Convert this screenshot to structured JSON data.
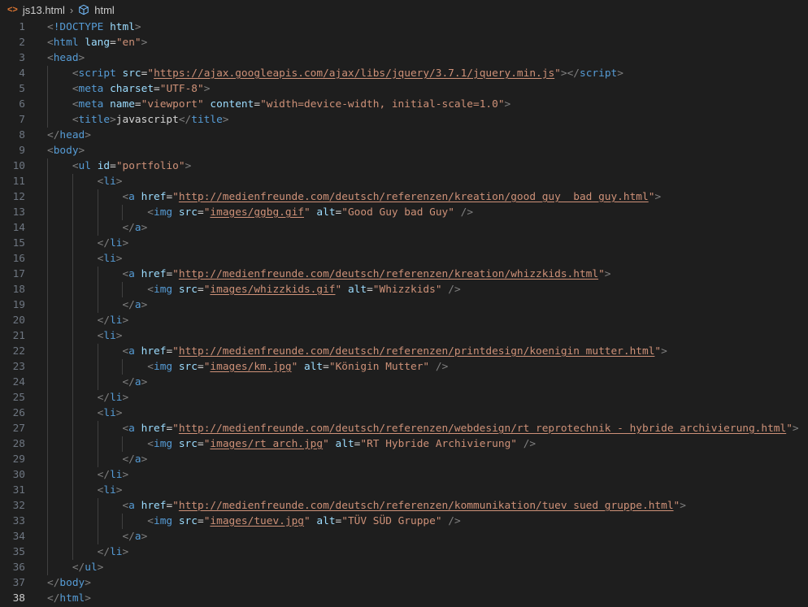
{
  "breadcrumb": {
    "file_icon": "<>",
    "file": "js13.html",
    "symbol_icon": "cube-icon",
    "symbol": "html"
  },
  "editor": {
    "active_line": 38,
    "lines": [
      {
        "n": "1",
        "indent": 0,
        "tokens": [
          [
            "punc",
            "<"
          ],
          [
            "tag",
            "!DOCTYPE"
          ],
          [
            "text",
            " "
          ],
          [
            "attr",
            "html"
          ],
          [
            "punc",
            ">"
          ]
        ]
      },
      {
        "n": "2",
        "indent": 0,
        "tokens": [
          [
            "punc",
            "<"
          ],
          [
            "tag",
            "html"
          ],
          [
            "text",
            " "
          ],
          [
            "attr",
            "lang"
          ],
          [
            "text",
            "="
          ],
          [
            "str",
            "\"en\""
          ],
          [
            "punc",
            ">"
          ]
        ]
      },
      {
        "n": "3",
        "indent": 0,
        "tokens": [
          [
            "punc",
            "<"
          ],
          [
            "tag",
            "head"
          ],
          [
            "punc",
            ">"
          ]
        ]
      },
      {
        "n": "4",
        "indent": 1,
        "tokens": [
          [
            "punc",
            "<"
          ],
          [
            "tag",
            "script"
          ],
          [
            "text",
            " "
          ],
          [
            "attr",
            "src"
          ],
          [
            "text",
            "="
          ],
          [
            "str",
            "\""
          ],
          [
            "link",
            "https://ajax.googleapis.com/ajax/libs/jquery/3.7.1/jquery.min.js"
          ],
          [
            "str",
            "\""
          ],
          [
            "punc",
            "></"
          ],
          [
            "tag",
            "script"
          ],
          [
            "punc",
            ">"
          ]
        ]
      },
      {
        "n": "5",
        "indent": 1,
        "tokens": [
          [
            "punc",
            "<"
          ],
          [
            "tag",
            "meta"
          ],
          [
            "text",
            " "
          ],
          [
            "attr",
            "charset"
          ],
          [
            "text",
            "="
          ],
          [
            "str",
            "\"UTF-8\""
          ],
          [
            "punc",
            ">"
          ]
        ]
      },
      {
        "n": "6",
        "indent": 1,
        "tokens": [
          [
            "punc",
            "<"
          ],
          [
            "tag",
            "meta"
          ],
          [
            "text",
            " "
          ],
          [
            "attr",
            "name"
          ],
          [
            "text",
            "="
          ],
          [
            "str",
            "\"viewport\""
          ],
          [
            "text",
            " "
          ],
          [
            "attr",
            "content"
          ],
          [
            "text",
            "="
          ],
          [
            "str",
            "\"width=device-width, initial-scale=1.0\""
          ],
          [
            "punc",
            ">"
          ]
        ]
      },
      {
        "n": "7",
        "indent": 1,
        "tokens": [
          [
            "punc",
            "<"
          ],
          [
            "tag",
            "title"
          ],
          [
            "punc",
            ">"
          ],
          [
            "text",
            "javascript"
          ],
          [
            "punc",
            "</"
          ],
          [
            "tag",
            "title"
          ],
          [
            "punc",
            ">"
          ]
        ]
      },
      {
        "n": "8",
        "indent": 0,
        "tokens": [
          [
            "punc",
            "</"
          ],
          [
            "tag",
            "head"
          ],
          [
            "punc",
            ">"
          ]
        ]
      },
      {
        "n": "9",
        "indent": 0,
        "tokens": [
          [
            "punc",
            "<"
          ],
          [
            "tag",
            "body"
          ],
          [
            "punc",
            ">"
          ]
        ]
      },
      {
        "n": "10",
        "indent": 1,
        "tokens": [
          [
            "punc",
            "<"
          ],
          [
            "tag",
            "ul"
          ],
          [
            "text",
            " "
          ],
          [
            "attr",
            "id"
          ],
          [
            "text",
            "="
          ],
          [
            "str",
            "\"portfolio\""
          ],
          [
            "punc",
            ">"
          ]
        ]
      },
      {
        "n": "11",
        "indent": 2,
        "tokens": [
          [
            "punc",
            "<"
          ],
          [
            "tag",
            "li"
          ],
          [
            "punc",
            ">"
          ]
        ]
      },
      {
        "n": "12",
        "indent": 3,
        "tokens": [
          [
            "punc",
            "<"
          ],
          [
            "tag",
            "a"
          ],
          [
            "text",
            " "
          ],
          [
            "attr",
            "href"
          ],
          [
            "text",
            "="
          ],
          [
            "str",
            "\""
          ],
          [
            "link",
            "http://medienfreunde.com/deutsch/referenzen/kreation/good_guy__bad_guy.html"
          ],
          [
            "str",
            "\""
          ],
          [
            "punc",
            ">"
          ]
        ]
      },
      {
        "n": "13",
        "indent": 4,
        "tokens": [
          [
            "punc",
            "<"
          ],
          [
            "tag",
            "img"
          ],
          [
            "text",
            " "
          ],
          [
            "attr",
            "src"
          ],
          [
            "text",
            "="
          ],
          [
            "str",
            "\""
          ],
          [
            "link",
            "images/ggbg.gif"
          ],
          [
            "str",
            "\""
          ],
          [
            "text",
            " "
          ],
          [
            "attr",
            "alt"
          ],
          [
            "text",
            "="
          ],
          [
            "str",
            "\"Good Guy bad Guy\""
          ],
          [
            "text",
            " "
          ],
          [
            "punc",
            "/>"
          ]
        ]
      },
      {
        "n": "14",
        "indent": 3,
        "tokens": [
          [
            "punc",
            "</"
          ],
          [
            "tag",
            "a"
          ],
          [
            "punc",
            ">"
          ]
        ]
      },
      {
        "n": "15",
        "indent": 2,
        "tokens": [
          [
            "punc",
            "</"
          ],
          [
            "tag",
            "li"
          ],
          [
            "punc",
            ">"
          ]
        ]
      },
      {
        "n": "16",
        "indent": 2,
        "tokens": [
          [
            "punc",
            "<"
          ],
          [
            "tag",
            "li"
          ],
          [
            "punc",
            ">"
          ]
        ]
      },
      {
        "n": "17",
        "indent": 3,
        "tokens": [
          [
            "punc",
            "<"
          ],
          [
            "tag",
            "a"
          ],
          [
            "text",
            " "
          ],
          [
            "attr",
            "href"
          ],
          [
            "text",
            "="
          ],
          [
            "str",
            "\""
          ],
          [
            "link",
            "http://medienfreunde.com/deutsch/referenzen/kreation/whizzkids.html"
          ],
          [
            "str",
            "\""
          ],
          [
            "punc",
            ">"
          ]
        ]
      },
      {
        "n": "18",
        "indent": 4,
        "tokens": [
          [
            "punc",
            "<"
          ],
          [
            "tag",
            "img"
          ],
          [
            "text",
            " "
          ],
          [
            "attr",
            "src"
          ],
          [
            "text",
            "="
          ],
          [
            "str",
            "\""
          ],
          [
            "link",
            "images/whizzkids.gif"
          ],
          [
            "str",
            "\""
          ],
          [
            "text",
            " "
          ],
          [
            "attr",
            "alt"
          ],
          [
            "text",
            "="
          ],
          [
            "str",
            "\"Whizzkids\""
          ],
          [
            "text",
            " "
          ],
          [
            "punc",
            "/>"
          ]
        ]
      },
      {
        "n": "19",
        "indent": 3,
        "tokens": [
          [
            "punc",
            "</"
          ],
          [
            "tag",
            "a"
          ],
          [
            "punc",
            ">"
          ]
        ]
      },
      {
        "n": "20",
        "indent": 2,
        "tokens": [
          [
            "punc",
            "</"
          ],
          [
            "tag",
            "li"
          ],
          [
            "punc",
            ">"
          ]
        ]
      },
      {
        "n": "21",
        "indent": 2,
        "tokens": [
          [
            "punc",
            "<"
          ],
          [
            "tag",
            "li"
          ],
          [
            "punc",
            ">"
          ]
        ]
      },
      {
        "n": "22",
        "indent": 3,
        "tokens": [
          [
            "punc",
            "<"
          ],
          [
            "tag",
            "a"
          ],
          [
            "text",
            " "
          ],
          [
            "attr",
            "href"
          ],
          [
            "text",
            "="
          ],
          [
            "str",
            "\""
          ],
          [
            "link",
            "http://medienfreunde.com/deutsch/referenzen/printdesign/koenigin_mutter.html"
          ],
          [
            "str",
            "\""
          ],
          [
            "punc",
            ">"
          ]
        ]
      },
      {
        "n": "23",
        "indent": 4,
        "tokens": [
          [
            "punc",
            "<"
          ],
          [
            "tag",
            "img"
          ],
          [
            "text",
            " "
          ],
          [
            "attr",
            "src"
          ],
          [
            "text",
            "="
          ],
          [
            "str",
            "\""
          ],
          [
            "link",
            "images/km.jpg"
          ],
          [
            "str",
            "\""
          ],
          [
            "text",
            " "
          ],
          [
            "attr",
            "alt"
          ],
          [
            "text",
            "="
          ],
          [
            "str",
            "\"Königin Mutter\""
          ],
          [
            "text",
            " "
          ],
          [
            "punc",
            "/>"
          ]
        ]
      },
      {
        "n": "24",
        "indent": 3,
        "tokens": [
          [
            "punc",
            "</"
          ],
          [
            "tag",
            "a"
          ],
          [
            "punc",
            ">"
          ]
        ]
      },
      {
        "n": "25",
        "indent": 2,
        "tokens": [
          [
            "punc",
            "</"
          ],
          [
            "tag",
            "li"
          ],
          [
            "punc",
            ">"
          ]
        ]
      },
      {
        "n": "26",
        "indent": 2,
        "tokens": [
          [
            "punc",
            "<"
          ],
          [
            "tag",
            "li"
          ],
          [
            "punc",
            ">"
          ]
        ]
      },
      {
        "n": "27",
        "indent": 3,
        "tokens": [
          [
            "punc",
            "<"
          ],
          [
            "tag",
            "a"
          ],
          [
            "text",
            " "
          ],
          [
            "attr",
            "href"
          ],
          [
            "text",
            "="
          ],
          [
            "str",
            "\""
          ],
          [
            "link",
            "http://medienfreunde.com/deutsch/referenzen/webdesign/rt_reprotechnik_-_hybride_archivierung.html"
          ],
          [
            "str",
            "\""
          ],
          [
            "punc",
            ">"
          ]
        ]
      },
      {
        "n": "28",
        "indent": 4,
        "tokens": [
          [
            "punc",
            "<"
          ],
          [
            "tag",
            "img"
          ],
          [
            "text",
            " "
          ],
          [
            "attr",
            "src"
          ],
          [
            "text",
            "="
          ],
          [
            "str",
            "\""
          ],
          [
            "link",
            "images/rt_arch.jpg"
          ],
          [
            "str",
            "\""
          ],
          [
            "text",
            " "
          ],
          [
            "attr",
            "alt"
          ],
          [
            "text",
            "="
          ],
          [
            "str",
            "\"RT Hybride Archivierung\""
          ],
          [
            "text",
            " "
          ],
          [
            "punc",
            "/>"
          ]
        ]
      },
      {
        "n": "29",
        "indent": 3,
        "tokens": [
          [
            "punc",
            "</"
          ],
          [
            "tag",
            "a"
          ],
          [
            "punc",
            ">"
          ]
        ]
      },
      {
        "n": "30",
        "indent": 2,
        "tokens": [
          [
            "punc",
            "</"
          ],
          [
            "tag",
            "li"
          ],
          [
            "punc",
            ">"
          ]
        ]
      },
      {
        "n": "31",
        "indent": 2,
        "tokens": [
          [
            "punc",
            "<"
          ],
          [
            "tag",
            "li"
          ],
          [
            "punc",
            ">"
          ]
        ]
      },
      {
        "n": "32",
        "indent": 3,
        "tokens": [
          [
            "punc",
            "<"
          ],
          [
            "tag",
            "a"
          ],
          [
            "text",
            " "
          ],
          [
            "attr",
            "href"
          ],
          [
            "text",
            "="
          ],
          [
            "str",
            "\""
          ],
          [
            "link",
            "http://medienfreunde.com/deutsch/referenzen/kommunikation/tuev_sued_gruppe.html"
          ],
          [
            "str",
            "\""
          ],
          [
            "punc",
            ">"
          ]
        ]
      },
      {
        "n": "33",
        "indent": 4,
        "tokens": [
          [
            "punc",
            "<"
          ],
          [
            "tag",
            "img"
          ],
          [
            "text",
            " "
          ],
          [
            "attr",
            "src"
          ],
          [
            "text",
            "="
          ],
          [
            "str",
            "\""
          ],
          [
            "link",
            "images/tuev.jpg"
          ],
          [
            "str",
            "\""
          ],
          [
            "text",
            " "
          ],
          [
            "attr",
            "alt"
          ],
          [
            "text",
            "="
          ],
          [
            "str",
            "\"TÜV SÜD Gruppe\""
          ],
          [
            "text",
            " "
          ],
          [
            "punc",
            "/>"
          ]
        ]
      },
      {
        "n": "34",
        "indent": 3,
        "tokens": [
          [
            "punc",
            "</"
          ],
          [
            "tag",
            "a"
          ],
          [
            "punc",
            ">"
          ]
        ]
      },
      {
        "n": "35",
        "indent": 2,
        "tokens": [
          [
            "punc",
            "</"
          ],
          [
            "tag",
            "li"
          ],
          [
            "punc",
            ">"
          ]
        ]
      },
      {
        "n": "36",
        "indent": 1,
        "tokens": [
          [
            "punc",
            "</"
          ],
          [
            "tag",
            "ul"
          ],
          [
            "punc",
            ">"
          ]
        ]
      },
      {
        "n": "37",
        "indent": 0,
        "tokens": [
          [
            "punc",
            "</"
          ],
          [
            "tag",
            "body"
          ],
          [
            "punc",
            ">"
          ]
        ]
      },
      {
        "n": "38",
        "indent": 0,
        "tokens": [
          [
            "punc",
            "</"
          ],
          [
            "tag",
            "html"
          ],
          [
            "punc",
            ">"
          ]
        ]
      }
    ]
  }
}
